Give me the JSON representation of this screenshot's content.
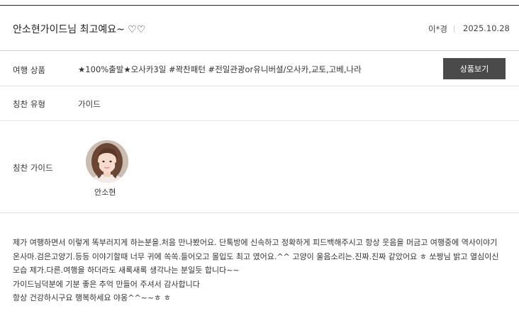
{
  "review": {
    "title": "안소현가이드님 최고예요~ ♡♡",
    "author": "이*경",
    "date": "2025.10.28"
  },
  "product": {
    "label": "여행 상품",
    "value": "★100%출발★오사카3일 #꽉찬패턴 #전일관광or유니버셜/오사카,교토,고베,나라",
    "button_label": "상품보기"
  },
  "praise_type": {
    "label": "칭찬 유형",
    "value": "가이드"
  },
  "praise_guide": {
    "label": "칭찬 가이드",
    "name": "안소현"
  },
  "body": {
    "lines": [
      "제가 여행하면서 이렇게 똑부러지게 하는분을.처음 만나봤어요. 단톡방에 신속하고 정확하게 피드백해주시고 항상 웃음을 머금고 여행중에 역사이야기",
      "온사마.검은고양기.등등 이야기할때 너무 귀에 쏙쏙.들어오고 몰입도 최고 였어요.^^ 고양이 울음소리는.진짜.진짜 같았어요 ㅎ 쏘짱님 밝고 열심이신",
      "모습 제가.다른.여행을 하더라도 새록새록 생각나는 분일듯 합니다~~",
      "가이드님덕분에 기분 좋은 추억 만들어 주셔서 감사합니다",
      "항상 건강하시구요 행복하세요 야옹^^~~ㅎ ㅎ"
    ]
  }
}
